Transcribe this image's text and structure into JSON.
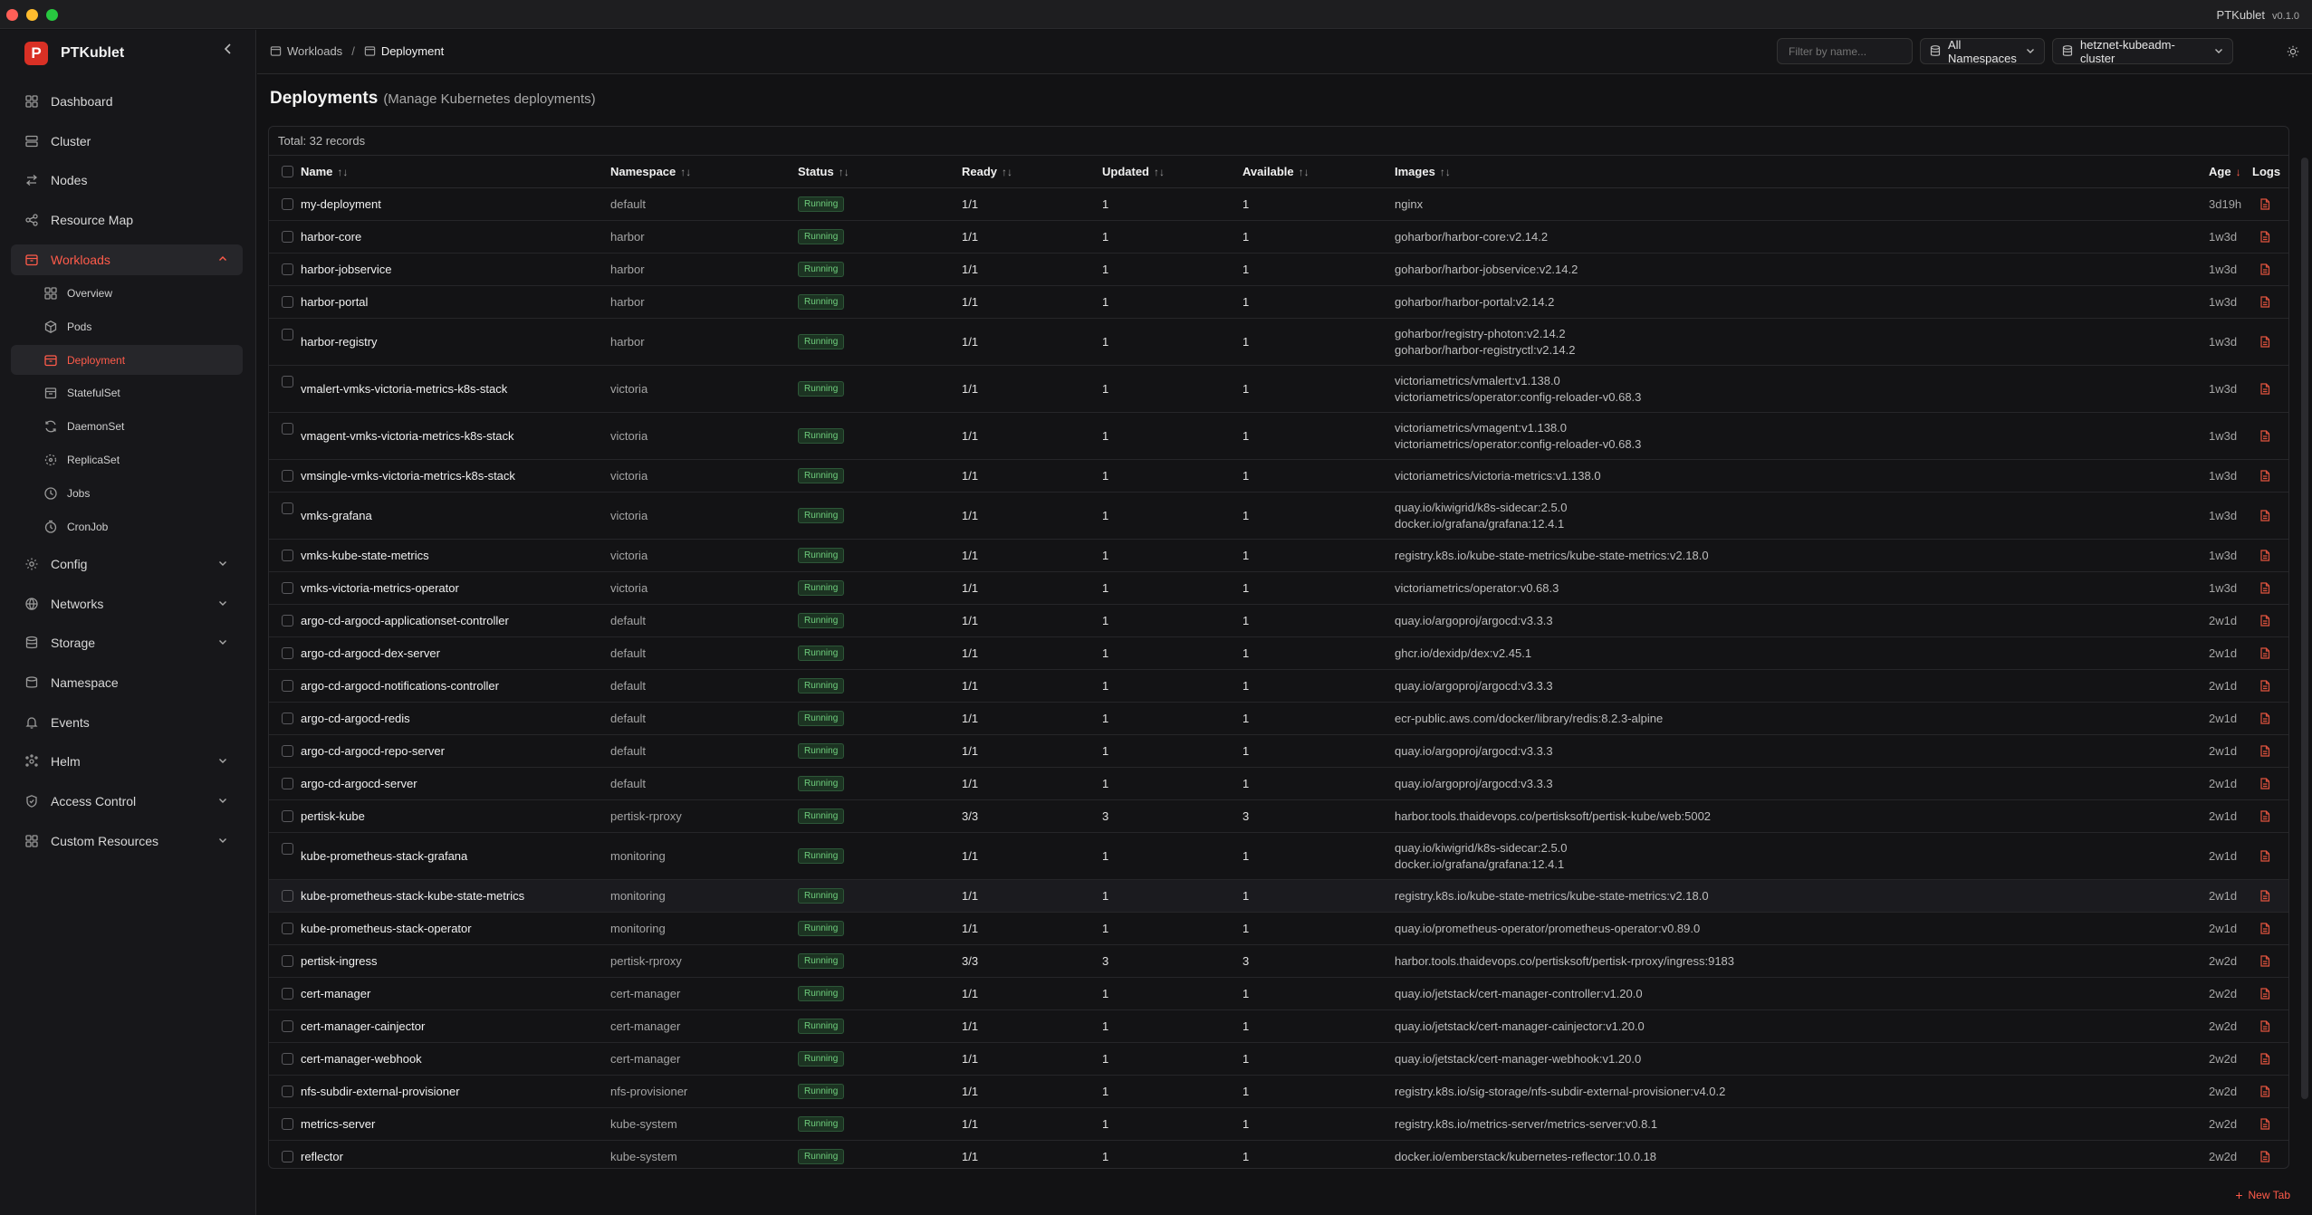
{
  "app": {
    "title": "PTKublet",
    "version": "v0.1.0"
  },
  "sidebar": {
    "brand": "PTKublet",
    "items": [
      {
        "label": "Dashboard",
        "icon": "grid-icon"
      },
      {
        "label": "Cluster",
        "icon": "server-icon"
      },
      {
        "label": "Nodes",
        "icon": "arrows-icon"
      },
      {
        "label": "Resource Map",
        "icon": "share-icon"
      },
      {
        "label": "Workloads",
        "icon": "box-icon",
        "open": true
      },
      {
        "label": "Config",
        "icon": "gear-icon"
      },
      {
        "label": "Networks",
        "icon": "globe-icon"
      },
      {
        "label": "Storage",
        "icon": "database-icon"
      },
      {
        "label": "Namespace",
        "icon": "layers-icon"
      },
      {
        "label": "Events",
        "icon": "bell-icon"
      },
      {
        "label": "Helm",
        "icon": "helm-icon"
      },
      {
        "label": "Access Control",
        "icon": "shield-icon"
      },
      {
        "label": "Custom Resources",
        "icon": "grid-icon"
      }
    ],
    "workloads_sub": [
      {
        "label": "Overview",
        "icon": "grid-icon"
      },
      {
        "label": "Pods",
        "icon": "cube-icon"
      },
      {
        "label": "Deployment",
        "icon": "box-icon",
        "active": true
      },
      {
        "label": "StatefulSet",
        "icon": "stack-icon"
      },
      {
        "label": "DaemonSet",
        "icon": "refresh-icon"
      },
      {
        "label": "ReplicaSet",
        "icon": "copy-icon"
      },
      {
        "label": "Jobs",
        "icon": "clock-icon"
      },
      {
        "label": "CronJob",
        "icon": "timer-icon"
      }
    ]
  },
  "header": {
    "breadcrumb": [
      "Workloads",
      "Deployment"
    ],
    "filter_placeholder": "Filter by name...",
    "namespace_select": "All Namespaces",
    "cluster_select": "hetznet-kubeadm-cluster"
  },
  "page": {
    "title": "Deployments",
    "subtitle": "(Manage Kubernetes deployments)",
    "total": "Total: 32 records",
    "new_tab": "New Tab"
  },
  "table": {
    "columns": [
      "Name",
      "Namespace",
      "Status",
      "Ready",
      "Updated",
      "Available",
      "Images",
      "Age",
      "Logs"
    ],
    "rows": [
      {
        "name": "my-deployment",
        "namespace": "default",
        "status": "Running",
        "ready": "1/1",
        "updated": "1",
        "available": "1",
        "images": [
          "nginx"
        ],
        "age": "3d19h"
      },
      {
        "name": "harbor-core",
        "namespace": "harbor",
        "status": "Running",
        "ready": "1/1",
        "updated": "1",
        "available": "1",
        "images": [
          "goharbor/harbor-core:v2.14.2"
        ],
        "age": "1w3d"
      },
      {
        "name": "harbor-jobservice",
        "namespace": "harbor",
        "status": "Running",
        "ready": "1/1",
        "updated": "1",
        "available": "1",
        "images": [
          "goharbor/harbor-jobservice:v2.14.2"
        ],
        "age": "1w3d"
      },
      {
        "name": "harbor-portal",
        "namespace": "harbor",
        "status": "Running",
        "ready": "1/1",
        "updated": "1",
        "available": "1",
        "images": [
          "goharbor/harbor-portal:v2.14.2"
        ],
        "age": "1w3d"
      },
      {
        "name": "harbor-registry",
        "namespace": "harbor",
        "status": "Running",
        "ready": "1/1",
        "updated": "1",
        "available": "1",
        "images": [
          "goharbor/registry-photon:v2.14.2",
          "goharbor/harbor-registryctl:v2.14.2"
        ],
        "age": "1w3d"
      },
      {
        "name": "vmalert-vmks-victoria-metrics-k8s-stack",
        "namespace": "victoria",
        "status": "Running",
        "ready": "1/1",
        "updated": "1",
        "available": "1",
        "images": [
          "victoriametrics/vmalert:v1.138.0",
          "victoriametrics/operator:config-reloader-v0.68.3"
        ],
        "age": "1w3d"
      },
      {
        "name": "vmagent-vmks-victoria-metrics-k8s-stack",
        "namespace": "victoria",
        "status": "Running",
        "ready": "1/1",
        "updated": "1",
        "available": "1",
        "images": [
          "victoriametrics/vmagent:v1.138.0",
          "victoriametrics/operator:config-reloader-v0.68.3"
        ],
        "age": "1w3d"
      },
      {
        "name": "vmsingle-vmks-victoria-metrics-k8s-stack",
        "namespace": "victoria",
        "status": "Running",
        "ready": "1/1",
        "updated": "1",
        "available": "1",
        "images": [
          "victoriametrics/victoria-metrics:v1.138.0"
        ],
        "age": "1w3d"
      },
      {
        "name": "vmks-grafana",
        "namespace": "victoria",
        "status": "Running",
        "ready": "1/1",
        "updated": "1",
        "available": "1",
        "images": [
          "quay.io/kiwigrid/k8s-sidecar:2.5.0",
          "docker.io/grafana/grafana:12.4.1"
        ],
        "age": "1w3d"
      },
      {
        "name": "vmks-kube-state-metrics",
        "namespace": "victoria",
        "status": "Running",
        "ready": "1/1",
        "updated": "1",
        "available": "1",
        "images": [
          "registry.k8s.io/kube-state-metrics/kube-state-metrics:v2.18.0"
        ],
        "age": "1w3d"
      },
      {
        "name": "vmks-victoria-metrics-operator",
        "namespace": "victoria",
        "status": "Running",
        "ready": "1/1",
        "updated": "1",
        "available": "1",
        "images": [
          "victoriametrics/operator:v0.68.3"
        ],
        "age": "1w3d"
      },
      {
        "name": "argo-cd-argocd-applicationset-controller",
        "namespace": "default",
        "status": "Running",
        "ready": "1/1",
        "updated": "1",
        "available": "1",
        "images": [
          "quay.io/argoproj/argocd:v3.3.3"
        ],
        "age": "2w1d"
      },
      {
        "name": "argo-cd-argocd-dex-server",
        "namespace": "default",
        "status": "Running",
        "ready": "1/1",
        "updated": "1",
        "available": "1",
        "images": [
          "ghcr.io/dexidp/dex:v2.45.1"
        ],
        "age": "2w1d"
      },
      {
        "name": "argo-cd-argocd-notifications-controller",
        "namespace": "default",
        "status": "Running",
        "ready": "1/1",
        "updated": "1",
        "available": "1",
        "images": [
          "quay.io/argoproj/argocd:v3.3.3"
        ],
        "age": "2w1d"
      },
      {
        "name": "argo-cd-argocd-redis",
        "namespace": "default",
        "status": "Running",
        "ready": "1/1",
        "updated": "1",
        "available": "1",
        "images": [
          "ecr-public.aws.com/docker/library/redis:8.2.3-alpine"
        ],
        "age": "2w1d"
      },
      {
        "name": "argo-cd-argocd-repo-server",
        "namespace": "default",
        "status": "Running",
        "ready": "1/1",
        "updated": "1",
        "available": "1",
        "images": [
          "quay.io/argoproj/argocd:v3.3.3"
        ],
        "age": "2w1d"
      },
      {
        "name": "argo-cd-argocd-server",
        "namespace": "default",
        "status": "Running",
        "ready": "1/1",
        "updated": "1",
        "available": "1",
        "images": [
          "quay.io/argoproj/argocd:v3.3.3"
        ],
        "age": "2w1d"
      },
      {
        "name": "pertisk-kube",
        "namespace": "pertisk-rproxy",
        "status": "Running",
        "ready": "3/3",
        "updated": "3",
        "available": "3",
        "images": [
          "harbor.tools.thaidevops.co/pertisksoft/pertisk-kube/web:5002"
        ],
        "age": "2w1d"
      },
      {
        "name": "kube-prometheus-stack-grafana",
        "namespace": "monitoring",
        "status": "Running",
        "ready": "1/1",
        "updated": "1",
        "available": "1",
        "images": [
          "quay.io/kiwigrid/k8s-sidecar:2.5.0",
          "docker.io/grafana/grafana:12.4.1"
        ],
        "age": "2w1d"
      },
      {
        "name": "kube-prometheus-stack-kube-state-metrics",
        "namespace": "monitoring",
        "status": "Running",
        "ready": "1/1",
        "updated": "1",
        "available": "1",
        "images": [
          "registry.k8s.io/kube-state-metrics/kube-state-metrics:v2.18.0"
        ],
        "age": "2w1d",
        "highlight": true
      },
      {
        "name": "kube-prometheus-stack-operator",
        "namespace": "monitoring",
        "status": "Running",
        "ready": "1/1",
        "updated": "1",
        "available": "1",
        "images": [
          "quay.io/prometheus-operator/prometheus-operator:v0.89.0"
        ],
        "age": "2w1d"
      },
      {
        "name": "pertisk-ingress",
        "namespace": "pertisk-rproxy",
        "status": "Running",
        "ready": "3/3",
        "updated": "3",
        "available": "3",
        "images": [
          "harbor.tools.thaidevops.co/pertisksoft/pertisk-rproxy/ingress:9183"
        ],
        "age": "2w2d"
      },
      {
        "name": "cert-manager",
        "namespace": "cert-manager",
        "status": "Running",
        "ready": "1/1",
        "updated": "1",
        "available": "1",
        "images": [
          "quay.io/jetstack/cert-manager-controller:v1.20.0"
        ],
        "age": "2w2d"
      },
      {
        "name": "cert-manager-cainjector",
        "namespace": "cert-manager",
        "status": "Running",
        "ready": "1/1",
        "updated": "1",
        "available": "1",
        "images": [
          "quay.io/jetstack/cert-manager-cainjector:v1.20.0"
        ],
        "age": "2w2d"
      },
      {
        "name": "cert-manager-webhook",
        "namespace": "cert-manager",
        "status": "Running",
        "ready": "1/1",
        "updated": "1",
        "available": "1",
        "images": [
          "quay.io/jetstack/cert-manager-webhook:v1.20.0"
        ],
        "age": "2w2d"
      },
      {
        "name": "nfs-subdir-external-provisioner",
        "namespace": "nfs-provisioner",
        "status": "Running",
        "ready": "1/1",
        "updated": "1",
        "available": "1",
        "images": [
          "registry.k8s.io/sig-storage/nfs-subdir-external-provisioner:v4.0.2"
        ],
        "age": "2w2d"
      },
      {
        "name": "metrics-server",
        "namespace": "kube-system",
        "status": "Running",
        "ready": "1/1",
        "updated": "1",
        "available": "1",
        "images": [
          "registry.k8s.io/metrics-server/metrics-server:v0.8.1"
        ],
        "age": "2w2d"
      },
      {
        "name": "reflector",
        "namespace": "kube-system",
        "status": "Running",
        "ready": "1/1",
        "updated": "1",
        "available": "1",
        "images": [
          "docker.io/emberstack/kubernetes-reflector:10.0.18"
        ],
        "age": "2w2d"
      }
    ]
  },
  "colors": {
    "accent": "#ff5b4a",
    "running": "#6fcf7d",
    "background": "#121214"
  }
}
